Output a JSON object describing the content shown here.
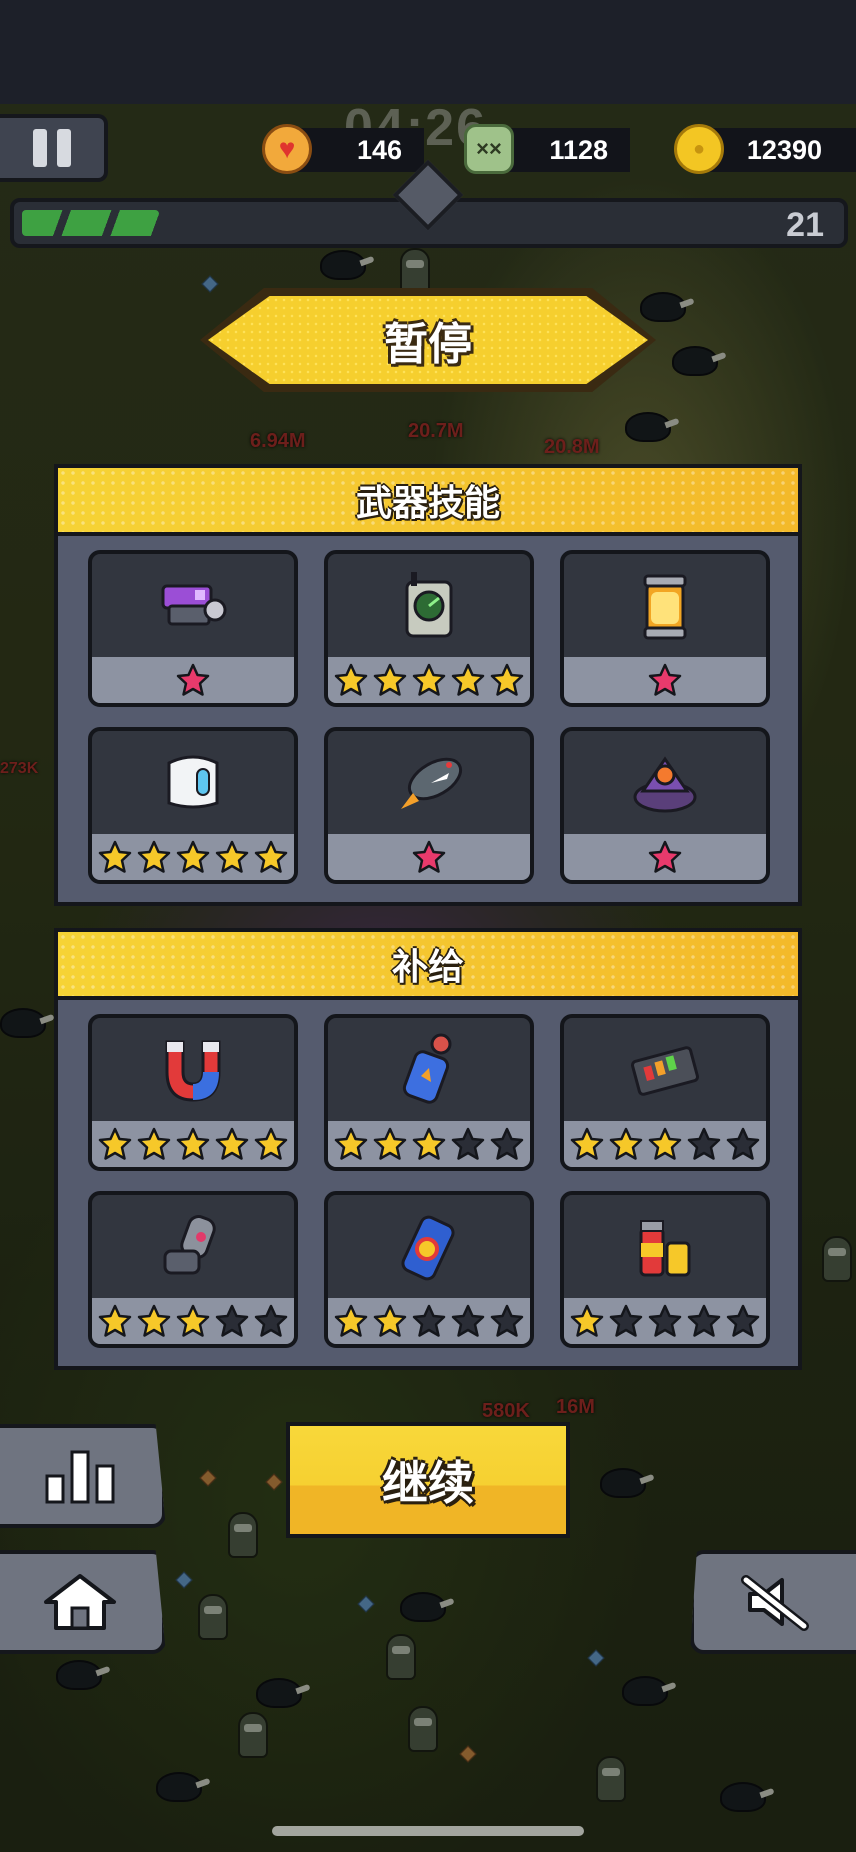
{
  "hud": {
    "timer": "04:26",
    "health": "146",
    "kills": "1128",
    "coins": "12390",
    "level": "21",
    "xp_progress": 0.17
  },
  "pause_title": "暂停",
  "weapons_panel": {
    "title": "武器技能",
    "items": [
      {
        "icon": "purple-blaster-icon",
        "stars": 1,
        "max_stars": 1
      },
      {
        "icon": "radar-device-icon",
        "stars": 5,
        "max_stars": 5
      },
      {
        "icon": "energy-canister-icon",
        "stars": 1,
        "max_stars": 1
      },
      {
        "icon": "white-drone-icon",
        "stars": 5,
        "max_stars": 5
      },
      {
        "icon": "shark-rocket-icon",
        "stars": 1,
        "max_stars": 1
      },
      {
        "icon": "purple-turret-icon",
        "stars": 1,
        "max_stars": 1
      }
    ]
  },
  "supplies_panel": {
    "title": "补给",
    "items": [
      {
        "icon": "magnet-icon",
        "stars": 5,
        "max_stars": 5
      },
      {
        "icon": "blue-potion-icon",
        "stars": 3,
        "max_stars": 5
      },
      {
        "icon": "battery-pack-icon",
        "stars": 3,
        "max_stars": 5
      },
      {
        "icon": "arm-cannon-icon",
        "stars": 3,
        "max_stars": 5
      },
      {
        "icon": "energy-drink-icon",
        "stars": 2,
        "max_stars": 5
      },
      {
        "icon": "ammo-shells-icon",
        "stars": 1,
        "max_stars": 5
      }
    ]
  },
  "continue_label": "继续",
  "colors": {
    "star_gold": "#f6c829",
    "star_pink": "#e83a6c",
    "star_empty": "#2a2d36",
    "accent_yellow": "#f6cf2e"
  },
  "background_damage": [
    "6.94M",
    "20.7M",
    "20.8M",
    "580K",
    "16M",
    "273K"
  ]
}
